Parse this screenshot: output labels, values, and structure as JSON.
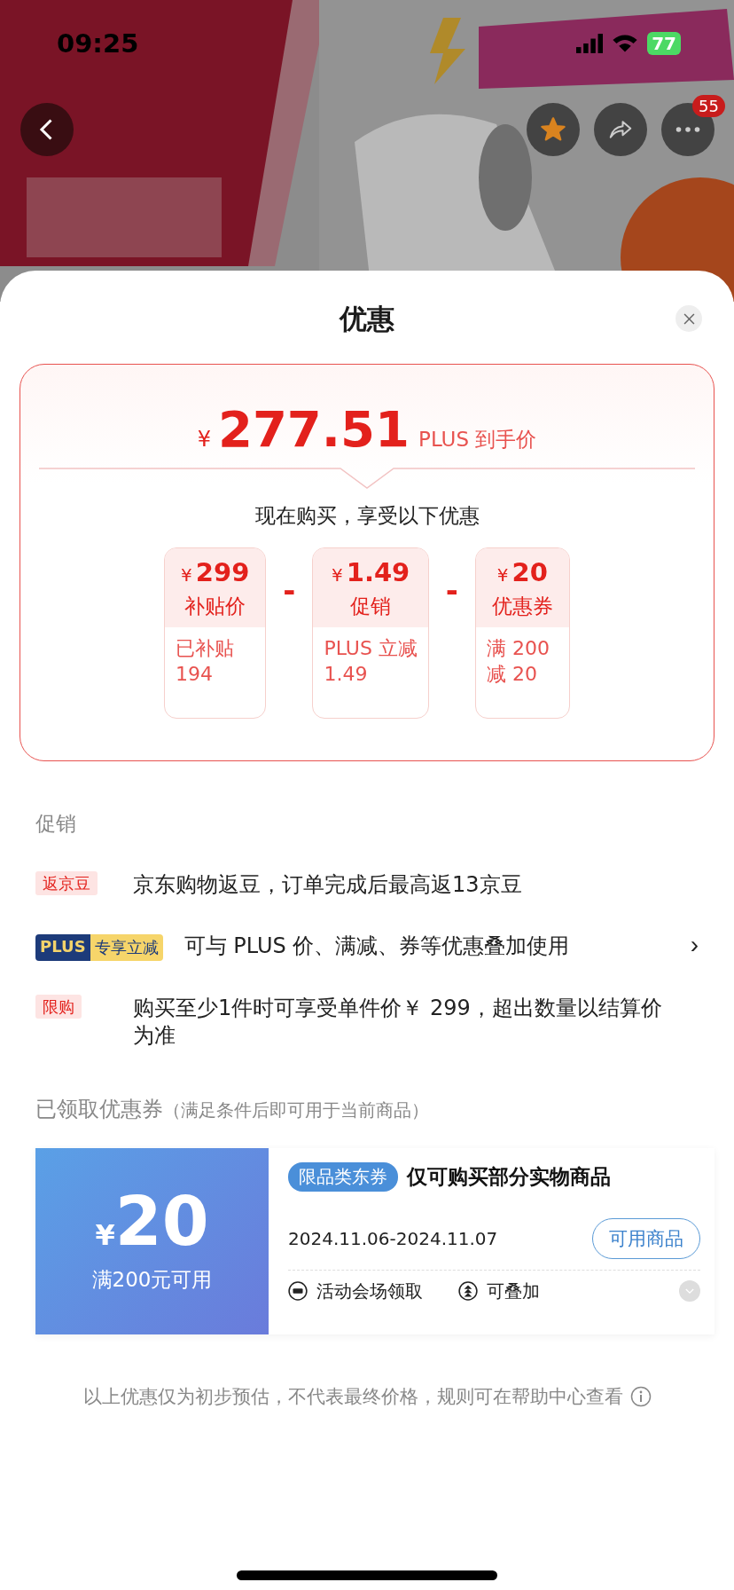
{
  "status_bar": {
    "time": "09:25",
    "battery": "77"
  },
  "header": {
    "more_badge": "55"
  },
  "sheet": {
    "title": "优惠"
  },
  "price_card": {
    "currency": "¥",
    "price": "277.51",
    "price_label": "PLUS 到手价",
    "subtitle": "现在购买，享受以下优惠",
    "items": [
      {
        "currency": "¥",
        "amount": "299",
        "name": "补贴价",
        "detail": "已补贴\n194"
      },
      {
        "currency": "¥",
        "amount": "1.49",
        "name": "促销",
        "detail": "PLUS 立减\n1.49"
      },
      {
        "currency": "¥",
        "amount": "20",
        "name": "优惠券",
        "detail": "满 200\n减 20"
      }
    ],
    "operators": [
      "-",
      "-"
    ]
  },
  "promotions": {
    "heading": "促销",
    "rows": [
      {
        "kind": "tag",
        "tag": "返京豆",
        "text": "京东购物返豆，订单完成后最高返13京豆"
      },
      {
        "kind": "plus",
        "plus": "PLUS",
        "tag": "专享立减",
        "text": "可与 PLUS 价、满减、券等优惠叠加使用",
        "chevron": "›"
      },
      {
        "kind": "tag",
        "tag": "限购",
        "text": "购买至少1件时可享受单件价￥ 299，超出数量以结算价为准"
      }
    ]
  },
  "coupons": {
    "heading": "已领取优惠券",
    "heading_note": "（满足条件后即可用于当前商品）",
    "items": [
      {
        "currency": "¥",
        "amount": "20",
        "condition": "满200元可用",
        "tag": "限品类东券",
        "title": "仅可购买部分实物商品",
        "validity": "2024.11.06-2024.11.07",
        "button": "可用商品",
        "features": [
          {
            "kind": "ticket",
            "text": "活动会场领取"
          },
          {
            "kind": "stack",
            "text": "可叠加"
          }
        ]
      }
    ]
  },
  "footer_note": "以上优惠仅为初步预估，不代表最终价格，规则可在帮助中心查看"
}
